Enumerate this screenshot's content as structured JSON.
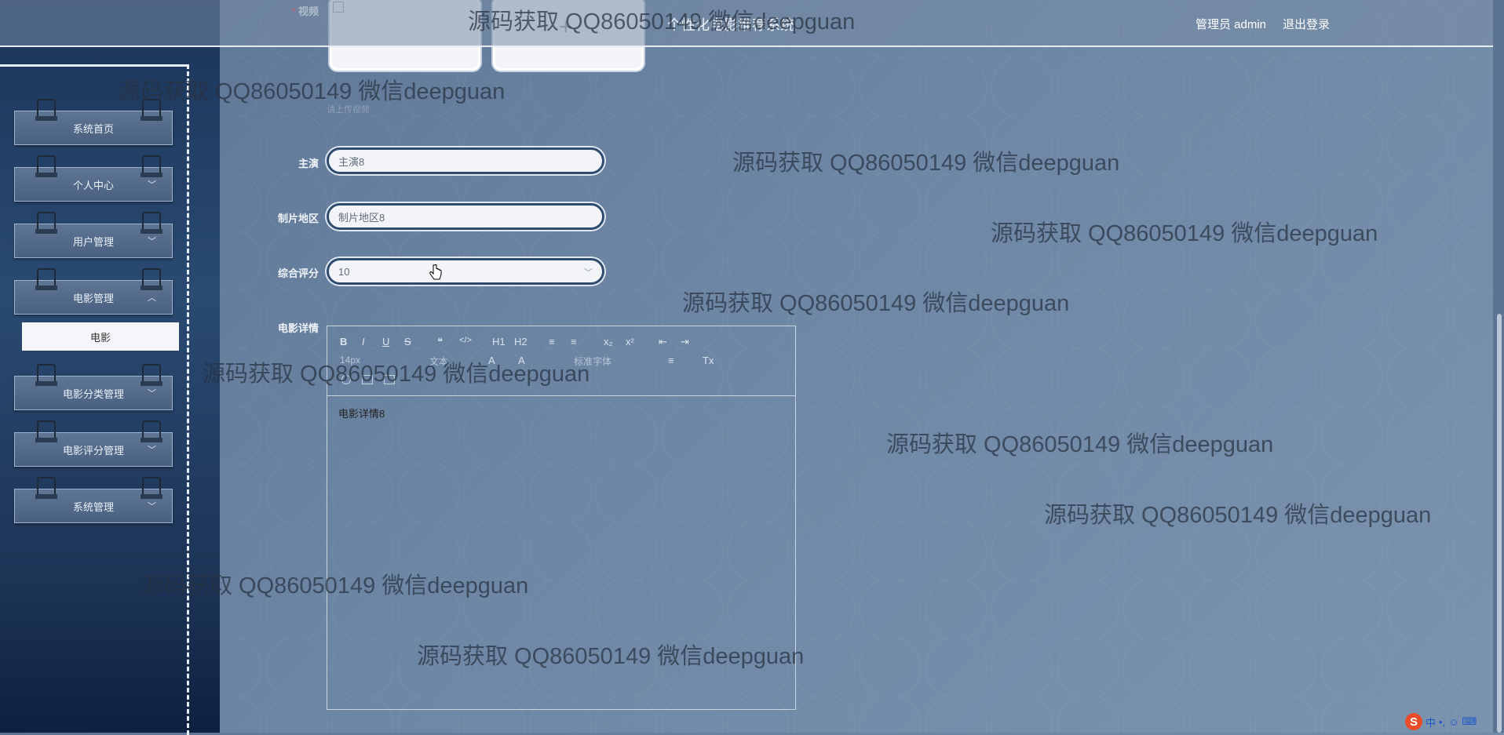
{
  "header": {
    "title": "个性化电影推荐系统",
    "user_label": "管理员 admin",
    "logout_label": "退出登录"
  },
  "sidebar": {
    "items": [
      {
        "label": "系统首页",
        "has_chevron": false
      },
      {
        "label": "个人中心",
        "has_chevron": true
      },
      {
        "label": "用户管理",
        "has_chevron": true
      },
      {
        "label": "电影管理",
        "has_chevron": true,
        "expanded": true
      },
      {
        "label": "电影分类管理",
        "has_chevron": true
      },
      {
        "label": "电影评分管理",
        "has_chevron": true
      },
      {
        "label": "系统管理",
        "has_chevron": true
      }
    ],
    "submenu": {
      "label": "电影"
    }
  },
  "form": {
    "video": {
      "label": "视频",
      "required_mark": "*",
      "hint": "请上传视频",
      "add_glyph": "+"
    },
    "actor": {
      "label": "主演",
      "value": "主演8"
    },
    "region": {
      "label": "制片地区",
      "value": "制片地区8"
    },
    "rating": {
      "label": "综合评分",
      "value": "10"
    },
    "detail": {
      "label": "电影详情",
      "content": "电影详情8",
      "toolbar_row1": [
        "B",
        "I",
        "U",
        "S",
        "❝",
        "</>",
        "H1",
        "H2",
        "≡",
        "≡",
        "x₂",
        "x²",
        "⇤",
        "⇥"
      ],
      "toolbar_row2": [
        "14px",
        "文本",
        "A",
        "A",
        "标准字体",
        "≡",
        "Tx"
      ]
    }
  },
  "watermarks": [
    "源码获取 QQ86050149 微信deepguan"
  ],
  "ime": {
    "label": "中"
  }
}
